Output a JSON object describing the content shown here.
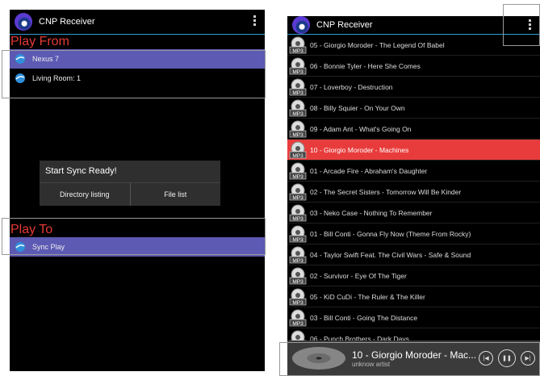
{
  "left": {
    "app_title": "CNP Receiver",
    "play_from": "Play From",
    "devices_from": [
      {
        "label": "Nexus 7"
      },
      {
        "label": "Living Room: 1"
      }
    ],
    "dialog": {
      "title": "Start Sync Ready!",
      "btn1": "Directory listing",
      "btn2": "File list"
    },
    "play_to": "Play To",
    "devices_to": [
      {
        "label": "Sync Play"
      }
    ]
  },
  "right": {
    "app_title": "CNP Receiver",
    "tracks": [
      "05 - Giorgio Moroder - The Legend Of Babel",
      "06 - Bonnie Tyler - Here She Comes",
      "07 - Loverboy - Destruction",
      "08 - Billy Squier - On Your Own",
      "09 - Adam Ant - What's Going On",
      "10 - Giorgio Moroder - Machines",
      "01 - Arcade Fire - Abraham's Daughter",
      "02 - The Secret Sisters - Tomorrow Will Be Kinder",
      "03 - Neko Case - Nothing To Remember",
      "01 - Bill Conti - Gonna Fly Now (Theme From Rocky)",
      "04 - Taylor Swift Feat. The Civil Wars - Safe & Sound",
      "02 - Survivor - Eye Of The Tiger",
      "05 - KiD CuDi - The Ruler & The Killer",
      "03 - Bill Conti - Going The Distance",
      "06 - Punch Brothers - Dark Days"
    ],
    "playing_index": 5,
    "mp3_badge": "MP3",
    "player": {
      "title": "10 - Giorgio Moroder - Mac...",
      "artist": "unknow artist"
    }
  },
  "colors": {
    "accent_red": "#e53935",
    "selected_blue": "#5c5ab3",
    "playing_red": "#e83c3c"
  }
}
